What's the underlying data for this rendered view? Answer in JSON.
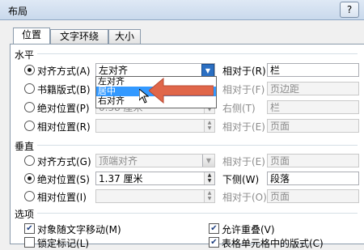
{
  "window": {
    "title": "布局",
    "help": "?"
  },
  "tabs": [
    {
      "label": "位置"
    },
    {
      "label": "文字环绕"
    },
    {
      "label": "大小"
    }
  ],
  "horizontal": {
    "label": "水平",
    "rows": [
      {
        "radio": "对齐方式(A)",
        "value": "左对齐",
        "rel_label": "相对于(R)",
        "rel_value": "栏"
      },
      {
        "radio": "书籍版式(B)",
        "value": "",
        "rel_label": "相对于(F)",
        "rel_value": "页边距"
      },
      {
        "radio": "绝对位置(P)",
        "value": "0.38 厘米",
        "rel_label": "右侧(T)",
        "rel_value": "栏"
      },
      {
        "radio": "相对位置(R)",
        "value": "",
        "rel_label": "相对于(E)",
        "rel_value": "页面"
      }
    ]
  },
  "dropdown": {
    "items": [
      "左对齐",
      "居中",
      "右对齐"
    ],
    "selected": 1
  },
  "vertical": {
    "label": "垂直",
    "rows": [
      {
        "radio": "对齐方式(G)",
        "value": "顶端对齐",
        "rel_label": "相对于(E)",
        "rel_value": "页面"
      },
      {
        "radio": "绝对位置(S)",
        "value": "1.37 厘米",
        "rel_label": "下侧(W)",
        "rel_value": "段落"
      },
      {
        "radio": "相对位置(I)",
        "value": "",
        "rel_label": "相对于(O)",
        "rel_value": "页面"
      }
    ]
  },
  "options": {
    "label": "选项",
    "items": [
      {
        "label": "对象随文字移动(M)",
        "checked": true
      },
      {
        "label": "允许重叠(V)",
        "checked": true
      },
      {
        "label": "锁定标记(L)",
        "checked": false
      },
      {
        "label": "表格单元格中的版式(C)",
        "checked": true
      }
    ]
  },
  "colors": {
    "accent": "#3399ff",
    "arrow": "#e0664a"
  }
}
